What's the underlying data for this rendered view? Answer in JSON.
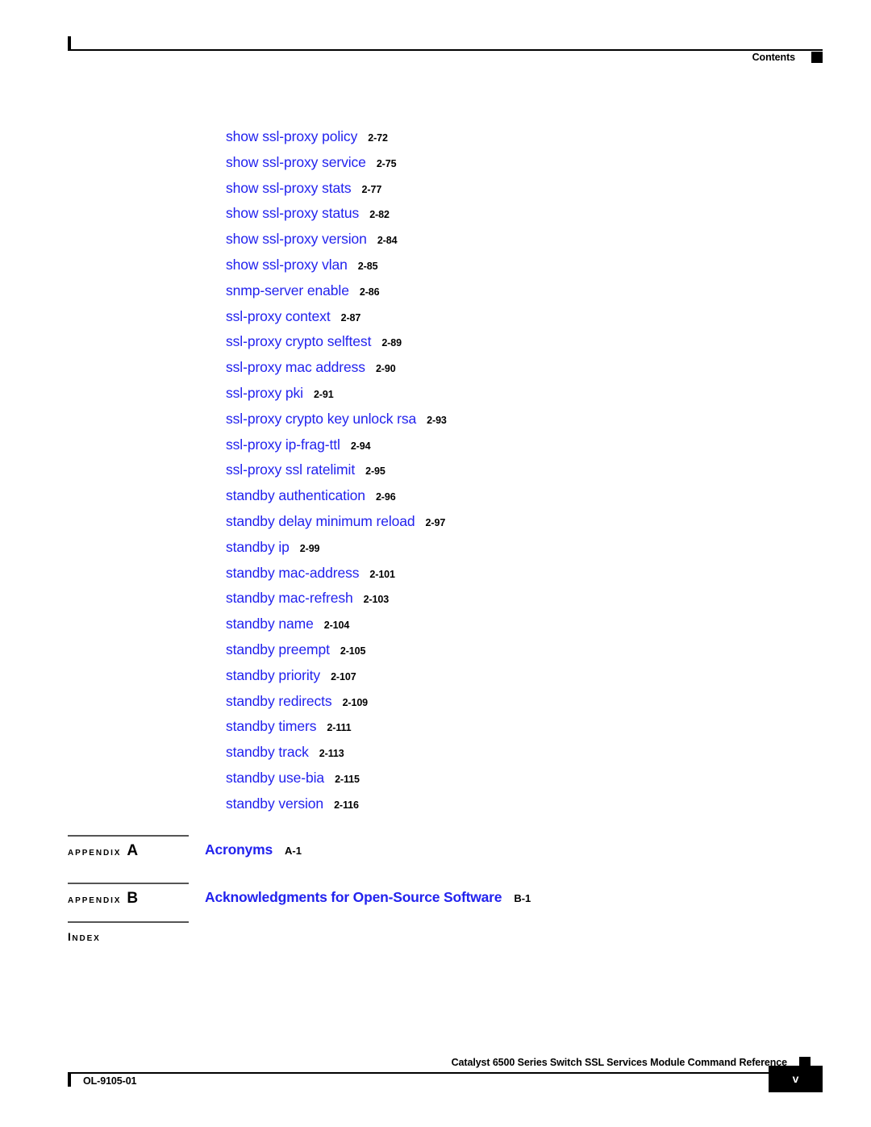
{
  "header": {
    "label": "Contents",
    "marker": "black-square"
  },
  "toc": {
    "entries": [
      {
        "title": "show ssl-proxy policy",
        "page": "2-72"
      },
      {
        "title": "show ssl-proxy service",
        "page": "2-75"
      },
      {
        "title": "show ssl-proxy stats",
        "page": "2-77"
      },
      {
        "title": "show ssl-proxy status",
        "page": "2-82"
      },
      {
        "title": "show ssl-proxy version",
        "page": "2-84"
      },
      {
        "title": "show ssl-proxy vlan",
        "page": "2-85"
      },
      {
        "title": "snmp-server enable",
        "page": "2-86"
      },
      {
        "title": "ssl-proxy context",
        "page": "2-87"
      },
      {
        "title": "ssl-proxy crypto selftest",
        "page": "2-89"
      },
      {
        "title": "ssl-proxy mac address",
        "page": "2-90"
      },
      {
        "title": "ssl-proxy pki",
        "page": "2-91"
      },
      {
        "title": "ssl-proxy crypto key unlock rsa",
        "page": "2-93"
      },
      {
        "title": "ssl-proxy ip-frag-ttl",
        "page": "2-94"
      },
      {
        "title": "ssl-proxy ssl ratelimit",
        "page": "2-95"
      },
      {
        "title": "standby authentication",
        "page": "2-96"
      },
      {
        "title": "standby delay minimum reload",
        "page": "2-97"
      },
      {
        "title": "standby ip",
        "page": "2-99"
      },
      {
        "title": "standby mac-address",
        "page": "2-101"
      },
      {
        "title": "standby mac-refresh",
        "page": "2-103"
      },
      {
        "title": "standby name",
        "page": "2-104"
      },
      {
        "title": "standby preempt",
        "page": "2-105"
      },
      {
        "title": "standby priority",
        "page": "2-107"
      },
      {
        "title": "standby redirects",
        "page": "2-109"
      },
      {
        "title": "standby timers",
        "page": "2-111"
      },
      {
        "title": "standby track",
        "page": "2-113"
      },
      {
        "title": "standby use-bia",
        "page": "2-115"
      },
      {
        "title": "standby version",
        "page": "2-116"
      }
    ]
  },
  "appendices": {
    "a": {
      "tag_word": "APPENDIX",
      "tag_letter": "A",
      "title": "Acronyms",
      "page": "A-1"
    },
    "b": {
      "tag_word": "APPENDIX",
      "tag_letter": "B",
      "title": "Acknowledgments for Open-Source Software",
      "page": "B-1"
    },
    "index": {
      "tag_first": "I",
      "tag_rest": "NDEX"
    }
  },
  "footer": {
    "title": "Catalyst 6500 Series Switch SSL Services Module Command Reference",
    "doc_number": "OL-9105-01",
    "page_number": "v",
    "marker": "black-square"
  },
  "colors": {
    "link_blue": "#2222ee",
    "text_black": "#000000",
    "rule_gray": "#555555"
  }
}
